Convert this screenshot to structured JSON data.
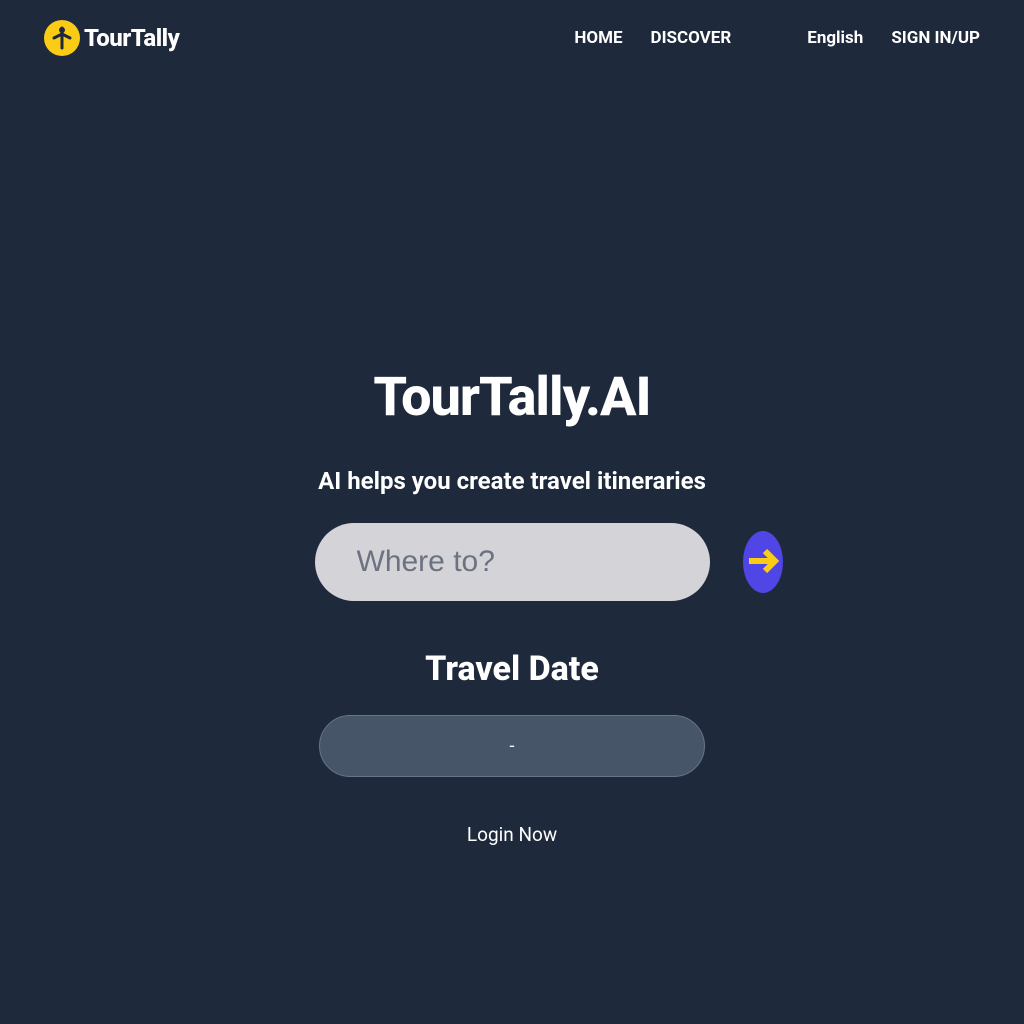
{
  "header": {
    "logo_text": "TourTally",
    "nav": {
      "home": "HOME",
      "discover": "DISCOVER",
      "language": "English",
      "signin": "SIGN IN/UP"
    }
  },
  "main": {
    "title": "TourTally.AI",
    "subtitle": "AI helps you create travel itineraries",
    "search_placeholder": "Where to?",
    "travel_date_label": "Travel Date",
    "travel_date_value": "-",
    "login_now": "Login Now"
  }
}
